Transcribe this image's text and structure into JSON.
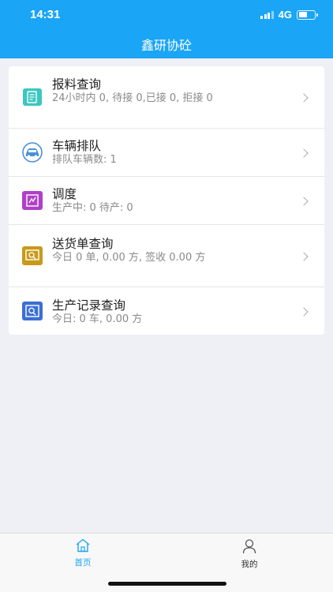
{
  "status_bar": {
    "time": "14:31",
    "network": "4G",
    "battery_percent": 55
  },
  "header": {
    "title": "鑫研协砼"
  },
  "menu": [
    {
      "title": "报料查询",
      "subtitle": "24小时内 0, 待接 0,已接 0, 拒接 0",
      "icon": "document-icon",
      "color": "#3cc7c0"
    },
    {
      "title": "车辆排队",
      "subtitle": "排队车辆数: 1",
      "icon": "car-icon",
      "color": "#4a90d9"
    },
    {
      "title": "调度",
      "subtitle": "生产中: 0 待产: 0",
      "icon": "dispatch-icon",
      "color": "#b040c8"
    },
    {
      "title": "送货单查询",
      "subtitle": "今日 0 单, 0.00 方, 签收 0.00 方",
      "icon": "delivery-search-icon",
      "color": "#c99a1a"
    },
    {
      "title": "生产记录查询",
      "subtitle": "今日: 0 车, 0.00 方",
      "icon": "record-search-icon",
      "color": "#3b6fd6"
    }
  ],
  "tabbar": {
    "home_label": "首页",
    "mine_label": "我的",
    "active_color": "#1aa5f6",
    "inactive_color": "#333333"
  }
}
